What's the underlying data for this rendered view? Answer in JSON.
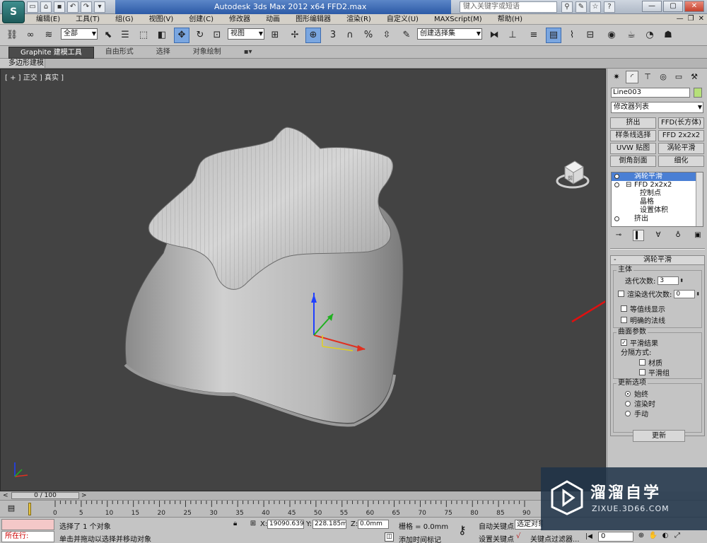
{
  "app": {
    "logo": "S",
    "title": "Autodesk 3ds Max  2012 x64      FFD2.max",
    "search_placeholder": "键入关键字或短语"
  },
  "menu": [
    "编辑(E)",
    "工具(T)",
    "组(G)",
    "视图(V)",
    "创建(C)",
    "修改器",
    "动画",
    "图形编辑器",
    "渲染(R)",
    "自定义(U)",
    "MAXScript(M)",
    "帮助(H)"
  ],
  "toolbar": {
    "selection_filter": "全部",
    "ref_coord": "视图",
    "named_selection": "创建选择集",
    "snap_label": "3",
    "percent_label": "%"
  },
  "ribbon": {
    "tabs": [
      "Graphite 建模工具",
      "自由形式",
      "选择",
      "对象绘制"
    ],
    "sub_tab": "多边形建模"
  },
  "viewport": {
    "label": "[ + ] 正交 ] 真实 ]",
    "cube_face": "前"
  },
  "command_panel": {
    "object_name": "Line003",
    "modifier_list": "修改器列表",
    "modifier_buttons": [
      "挤出",
      "FFD(长方体)",
      "样条线选择",
      "FFD 2x2x2",
      "UVW 贴图",
      "涡轮平滑",
      "倒角剖面",
      "细化"
    ],
    "stack": [
      {
        "label": "涡轮平滑",
        "selected": true,
        "bulb": true,
        "indent": 0
      },
      {
        "label": "FFD 2x2x2",
        "selected": false,
        "bulb": true,
        "indent": 0,
        "expand": "⊟"
      },
      {
        "label": "控制点",
        "selected": false,
        "bulb": false,
        "indent": 2
      },
      {
        "label": "晶格",
        "selected": false,
        "bulb": false,
        "indent": 2
      },
      {
        "label": "设置体积",
        "selected": false,
        "bulb": false,
        "indent": 2
      },
      {
        "label": "挤出",
        "selected": false,
        "bulb": true,
        "indent": 0
      }
    ],
    "rollout_title": "涡轮平滑",
    "main_group": "主体",
    "iterations_label": "迭代次数:",
    "iterations_value": "3",
    "render_iters_label": "渲染迭代次数:",
    "render_iters_value": "0",
    "isoline": "等值线显示",
    "explicit_normals": "明确的法线",
    "surface_group": "曲面参数",
    "smooth_result": "平滑结果",
    "separate_by": "分隔方式:",
    "materials": "材质",
    "smoothing_groups": "平滑组",
    "update_group": "更新选项",
    "always": "始终",
    "when_rendering": "渲染时",
    "manually": "手动",
    "update_button": "更新"
  },
  "timeline": {
    "frame_display": "0 / 100",
    "ticks": [
      "0",
      "5",
      "10",
      "15",
      "20",
      "25",
      "30",
      "35",
      "40",
      "45",
      "50",
      "55",
      "60",
      "65",
      "70",
      "75",
      "80",
      "85",
      "90"
    ],
    "tick_min": 0,
    "tick_max": 90
  },
  "status": {
    "script_label": "所在行:",
    "selection": "选择了 1 个对象",
    "prompt": "单击并拖动以选择并移动对象",
    "x_label": "X:",
    "x_value": "19090.639",
    "y_label": "Y:",
    "y_value": "228.185mm",
    "z_label": "Z:",
    "z_value": "0.0mm",
    "grid": "栅格 = 0.0mm",
    "add_time_tag": "添加时间标记",
    "auto_key": "自动关键点",
    "set_key": "设置关键点",
    "selected_set": "选定对象",
    "key_filters": "关键点过滤器...",
    "frame_value": "0"
  },
  "watermark": {
    "name": "溜溜自学",
    "url": "ZIXUE.3D66.COM"
  },
  "colors": {
    "viewport_bg": "#434343",
    "selection_blue": "#4a7fd4",
    "annotation_red": "#e01010",
    "object_color": "#b6e07a"
  }
}
